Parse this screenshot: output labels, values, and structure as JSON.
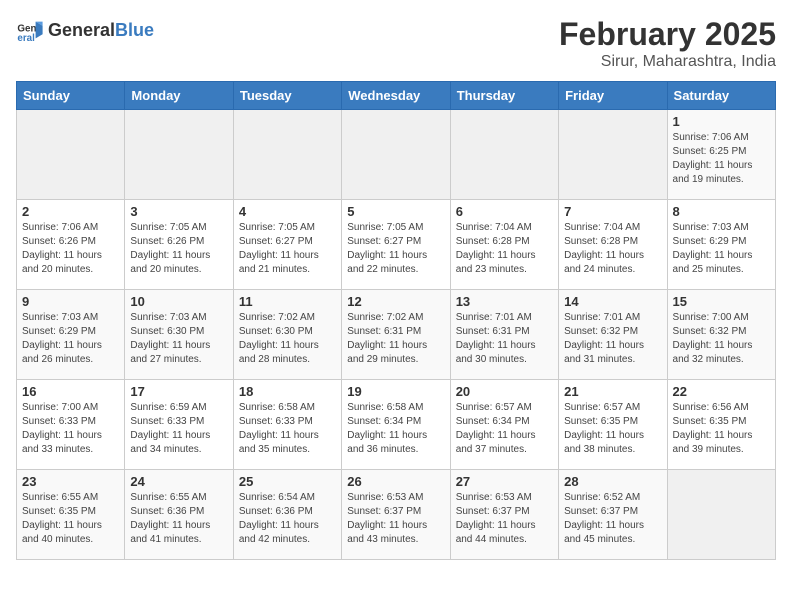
{
  "header": {
    "logo_general": "General",
    "logo_blue": "Blue",
    "title": "February 2025",
    "subtitle": "Sirur, Maharashtra, India"
  },
  "calendar": {
    "days_of_week": [
      "Sunday",
      "Monday",
      "Tuesday",
      "Wednesday",
      "Thursday",
      "Friday",
      "Saturday"
    ],
    "weeks": [
      [
        {
          "day": "",
          "info": ""
        },
        {
          "day": "",
          "info": ""
        },
        {
          "day": "",
          "info": ""
        },
        {
          "day": "",
          "info": ""
        },
        {
          "day": "",
          "info": ""
        },
        {
          "day": "",
          "info": ""
        },
        {
          "day": "1",
          "info": "Sunrise: 7:06 AM\nSunset: 6:25 PM\nDaylight: 11 hours\nand 19 minutes."
        }
      ],
      [
        {
          "day": "2",
          "info": "Sunrise: 7:06 AM\nSunset: 6:26 PM\nDaylight: 11 hours\nand 20 minutes."
        },
        {
          "day": "3",
          "info": "Sunrise: 7:05 AM\nSunset: 6:26 PM\nDaylight: 11 hours\nand 20 minutes."
        },
        {
          "day": "4",
          "info": "Sunrise: 7:05 AM\nSunset: 6:27 PM\nDaylight: 11 hours\nand 21 minutes."
        },
        {
          "day": "5",
          "info": "Sunrise: 7:05 AM\nSunset: 6:27 PM\nDaylight: 11 hours\nand 22 minutes."
        },
        {
          "day": "6",
          "info": "Sunrise: 7:04 AM\nSunset: 6:28 PM\nDaylight: 11 hours\nand 23 minutes."
        },
        {
          "day": "7",
          "info": "Sunrise: 7:04 AM\nSunset: 6:28 PM\nDaylight: 11 hours\nand 24 minutes."
        },
        {
          "day": "8",
          "info": "Sunrise: 7:03 AM\nSunset: 6:29 PM\nDaylight: 11 hours\nand 25 minutes."
        }
      ],
      [
        {
          "day": "9",
          "info": "Sunrise: 7:03 AM\nSunset: 6:29 PM\nDaylight: 11 hours\nand 26 minutes."
        },
        {
          "day": "10",
          "info": "Sunrise: 7:03 AM\nSunset: 6:30 PM\nDaylight: 11 hours\nand 27 minutes."
        },
        {
          "day": "11",
          "info": "Sunrise: 7:02 AM\nSunset: 6:30 PM\nDaylight: 11 hours\nand 28 minutes."
        },
        {
          "day": "12",
          "info": "Sunrise: 7:02 AM\nSunset: 6:31 PM\nDaylight: 11 hours\nand 29 minutes."
        },
        {
          "day": "13",
          "info": "Sunrise: 7:01 AM\nSunset: 6:31 PM\nDaylight: 11 hours\nand 30 minutes."
        },
        {
          "day": "14",
          "info": "Sunrise: 7:01 AM\nSunset: 6:32 PM\nDaylight: 11 hours\nand 31 minutes."
        },
        {
          "day": "15",
          "info": "Sunrise: 7:00 AM\nSunset: 6:32 PM\nDaylight: 11 hours\nand 32 minutes."
        }
      ],
      [
        {
          "day": "16",
          "info": "Sunrise: 7:00 AM\nSunset: 6:33 PM\nDaylight: 11 hours\nand 33 minutes."
        },
        {
          "day": "17",
          "info": "Sunrise: 6:59 AM\nSunset: 6:33 PM\nDaylight: 11 hours\nand 34 minutes."
        },
        {
          "day": "18",
          "info": "Sunrise: 6:58 AM\nSunset: 6:33 PM\nDaylight: 11 hours\nand 35 minutes."
        },
        {
          "day": "19",
          "info": "Sunrise: 6:58 AM\nSunset: 6:34 PM\nDaylight: 11 hours\nand 36 minutes."
        },
        {
          "day": "20",
          "info": "Sunrise: 6:57 AM\nSunset: 6:34 PM\nDaylight: 11 hours\nand 37 minutes."
        },
        {
          "day": "21",
          "info": "Sunrise: 6:57 AM\nSunset: 6:35 PM\nDaylight: 11 hours\nand 38 minutes."
        },
        {
          "day": "22",
          "info": "Sunrise: 6:56 AM\nSunset: 6:35 PM\nDaylight: 11 hours\nand 39 minutes."
        }
      ],
      [
        {
          "day": "23",
          "info": "Sunrise: 6:55 AM\nSunset: 6:35 PM\nDaylight: 11 hours\nand 40 minutes."
        },
        {
          "day": "24",
          "info": "Sunrise: 6:55 AM\nSunset: 6:36 PM\nDaylight: 11 hours\nand 41 minutes."
        },
        {
          "day": "25",
          "info": "Sunrise: 6:54 AM\nSunset: 6:36 PM\nDaylight: 11 hours\nand 42 minutes."
        },
        {
          "day": "26",
          "info": "Sunrise: 6:53 AM\nSunset: 6:37 PM\nDaylight: 11 hours\nand 43 minutes."
        },
        {
          "day": "27",
          "info": "Sunrise: 6:53 AM\nSunset: 6:37 PM\nDaylight: 11 hours\nand 44 minutes."
        },
        {
          "day": "28",
          "info": "Sunrise: 6:52 AM\nSunset: 6:37 PM\nDaylight: 11 hours\nand 45 minutes."
        },
        {
          "day": "",
          "info": ""
        }
      ]
    ]
  }
}
